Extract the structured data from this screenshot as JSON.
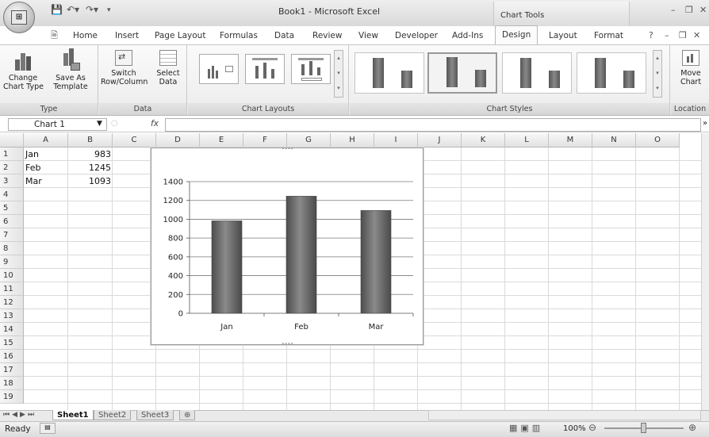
{
  "app": {
    "title": "Book1 - Microsoft Excel",
    "contextual_tab_group": "Chart Tools"
  },
  "tabs": [
    "Home",
    "Insert",
    "Page Layout",
    "Formulas",
    "Data",
    "Review",
    "View",
    "Developer",
    "Add-Ins",
    "Design",
    "Layout",
    "Format"
  ],
  "active_tab": "Design",
  "ribbon": {
    "type_group": {
      "label": "Type",
      "change_chart_type": "Change\nChart Type",
      "save_as_template": "Save As\nTemplate"
    },
    "data_group": {
      "label": "Data",
      "switch_row_column": "Switch\nRow/Column",
      "select_data": "Select\nData"
    },
    "layouts_group": {
      "label": "Chart Layouts"
    },
    "styles_group": {
      "label": "Chart Styles"
    },
    "location_group": {
      "label": "Location",
      "move_chart": "Move\nChart"
    }
  },
  "formula_bar": {
    "name_box": "Chart 1",
    "fx": "fx",
    "formula": ""
  },
  "columns": [
    "A",
    "B",
    "C",
    "D",
    "E",
    "F",
    "G",
    "H",
    "I",
    "J",
    "K",
    "L",
    "M",
    "N",
    "O"
  ],
  "rows": [
    "1",
    "2",
    "3",
    "4",
    "5",
    "6",
    "7",
    "8",
    "9",
    "10",
    "11",
    "12",
    "13",
    "14",
    "15",
    "16",
    "17",
    "18",
    "19"
  ],
  "cells": [
    {
      "ref": "A1",
      "value": "Jan"
    },
    {
      "ref": "B1",
      "value": "983"
    },
    {
      "ref": "A2",
      "value": "Feb"
    },
    {
      "ref": "B2",
      "value": "1245"
    },
    {
      "ref": "A3",
      "value": "Mar"
    },
    {
      "ref": "B3",
      "value": "1093"
    }
  ],
  "chart_data": {
    "type": "bar",
    "categories": [
      "Jan",
      "Feb",
      "Mar"
    ],
    "values": [
      983,
      1245,
      1093
    ],
    "ylim": [
      0,
      1400
    ],
    "yticks": [
      "0",
      "200",
      "400",
      "600",
      "800",
      "1000",
      "1200",
      "1400"
    ],
    "grid": true,
    "title": "",
    "xlabel": "",
    "ylabel": ""
  },
  "sheets": [
    "Sheet1",
    "Sheet2",
    "Sheet3"
  ],
  "active_sheet": "Sheet1",
  "status": {
    "text": "Ready",
    "zoom": "100%"
  }
}
